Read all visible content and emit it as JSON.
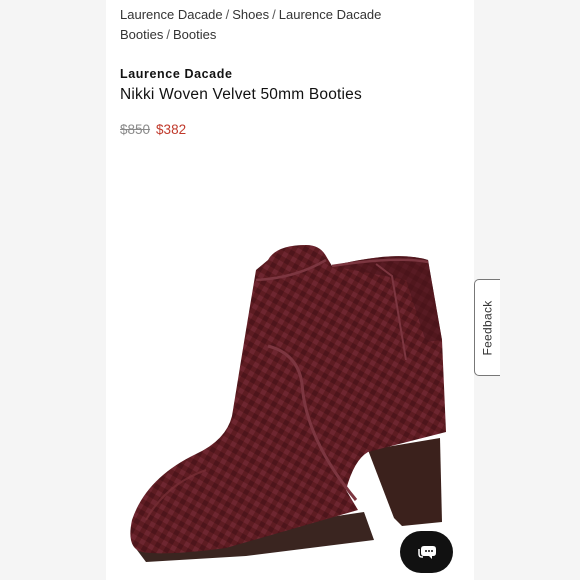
{
  "breadcrumb": {
    "items": [
      "Laurence Dacade",
      "Shoes",
      "Laurence Dacade Booties",
      "Booties"
    ],
    "separator": "/"
  },
  "product": {
    "brand": "Laurence Dacade",
    "title": "Nikki Woven Velvet 50mm Booties",
    "original_price": "$850",
    "sale_price": "$382",
    "image_icon": "burgundy-woven-velvet-ankle-bootie"
  },
  "feedback": {
    "label": "Feedback"
  },
  "chat": {
    "icon": "chat-bubble-icon"
  },
  "colors": {
    "sale_price": "#c0392b",
    "boot_burgundy": "#5e1c22",
    "chat_button": "#111111"
  }
}
